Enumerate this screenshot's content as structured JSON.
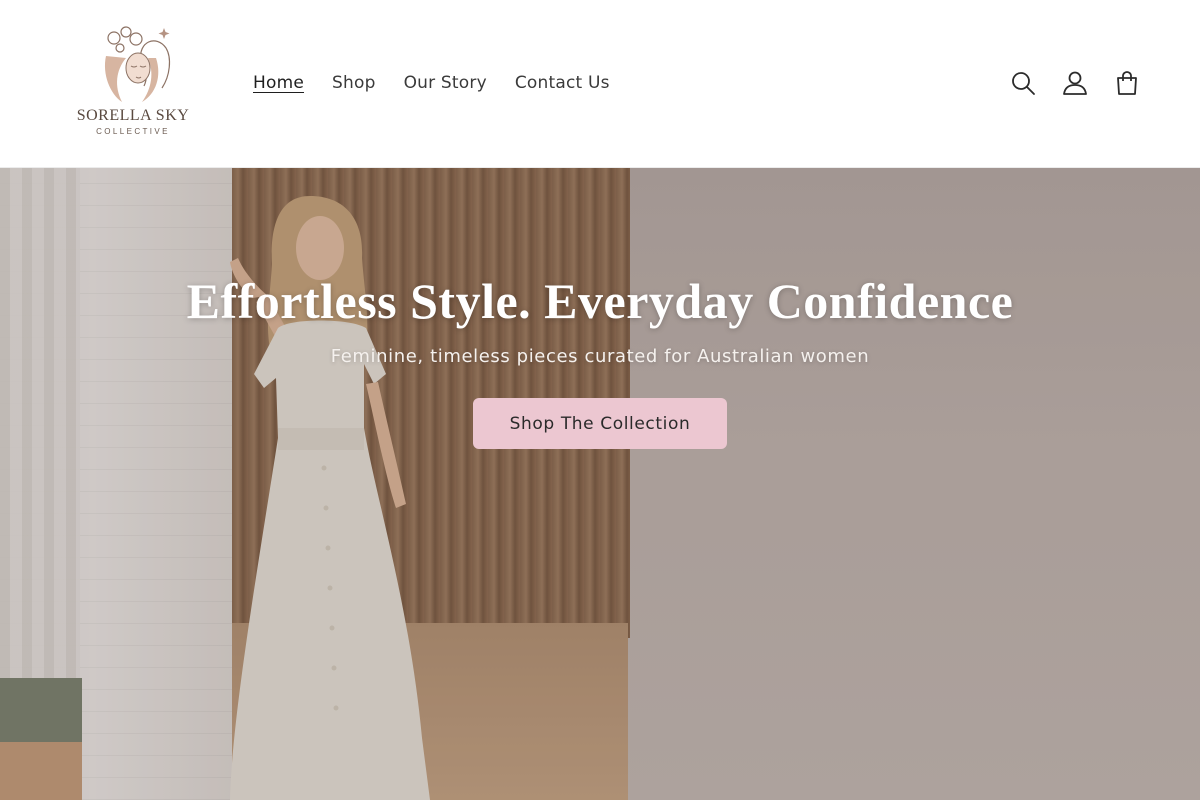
{
  "brand": {
    "name": "SORELLA SKY",
    "tagline": "COLLECTIVE"
  },
  "nav": {
    "items": [
      {
        "label": "Home",
        "active": true
      },
      {
        "label": "Shop",
        "active": false
      },
      {
        "label": "Our Story",
        "active": false
      },
      {
        "label": "Contact Us",
        "active": false
      }
    ]
  },
  "header_icons": [
    "search-icon",
    "account-icon",
    "cart-icon"
  ],
  "hero": {
    "title": "Effortless Style. Everyday Confidence",
    "subtitle": "Feminine, timeless pieces curated for Australian women",
    "cta_label": "Shop The Collection"
  },
  "colors": {
    "cta_background": "#ecc7d1",
    "hero_text": "#ffffff",
    "nav_text": "#3a3a3a"
  }
}
